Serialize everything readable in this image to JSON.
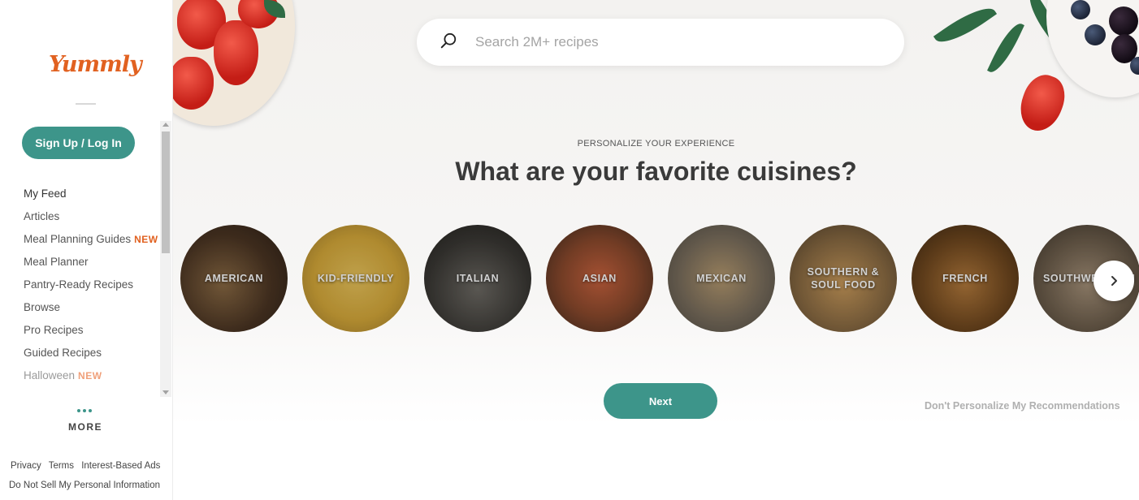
{
  "sidebar": {
    "logo": "Yummly",
    "signup_label": "Sign Up / Log In",
    "items": [
      {
        "label": "My Feed",
        "badge": ""
      },
      {
        "label": "Articles",
        "badge": ""
      },
      {
        "label": "Meal Planning Guides",
        "badge": "NEW"
      },
      {
        "label": "Meal Planner",
        "badge": ""
      },
      {
        "label": "Pantry-Ready Recipes",
        "badge": ""
      },
      {
        "label": "Browse",
        "badge": ""
      },
      {
        "label": "Pro Recipes",
        "badge": ""
      },
      {
        "label": "Guided Recipes",
        "badge": ""
      },
      {
        "label": "Halloween",
        "badge": "NEW"
      }
    ],
    "more_label": "MORE",
    "footer": {
      "privacy": "Privacy",
      "terms": "Terms",
      "ads": "Interest-Based Ads",
      "do_not_sell": "Do Not Sell My Personal Information"
    }
  },
  "search": {
    "placeholder": "Search 2M+ recipes"
  },
  "main": {
    "eyebrow": "PERSONALIZE YOUR EXPERIENCE",
    "headline": "What are your favorite cuisines?",
    "cuisines": [
      "AMERICAN",
      "KID-FRIENDLY",
      "ITALIAN",
      "ASIAN",
      "MEXICAN",
      "SOUTHERN & SOUL FOOD",
      "FRENCH",
      "SOUTHWESTERN"
    ],
    "next_label": "Next",
    "skip_label": "Don't Personalize My Recommendations"
  },
  "colors": {
    "brand_orange": "#e16120",
    "teal": "#3d958a"
  }
}
